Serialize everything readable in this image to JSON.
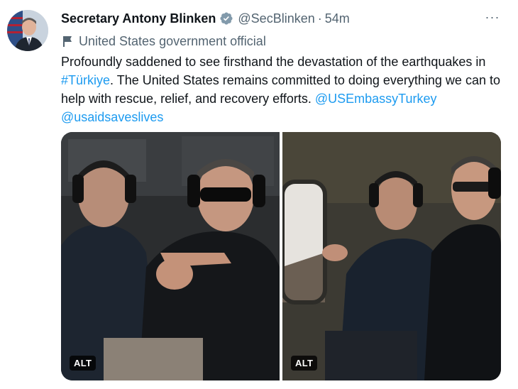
{
  "author": {
    "name": "Secretary Antony Blinken",
    "handle": "@SecBlinken",
    "separator": "·",
    "time": "54m",
    "label": "United States government official",
    "verified_color": "#829aab"
  },
  "more_label": "···",
  "tweet": {
    "text_1": "Profoundly saddened to see firsthand the devastation of the earthquakes in ",
    "hashtag": "#Türkiye",
    "text_2": ". The United States remains committed to doing everything we can to help with rescue, relief, and recovery efforts. ",
    "mention_1": "@USEmbassyTurkey",
    "mention_2": "@usaidsaveslives"
  },
  "media": [
    {
      "alt_badge": "ALT"
    },
    {
      "alt_badge": "ALT"
    }
  ],
  "colors": {
    "link": "#1d9bf0",
    "secondary_text": "#536471"
  }
}
